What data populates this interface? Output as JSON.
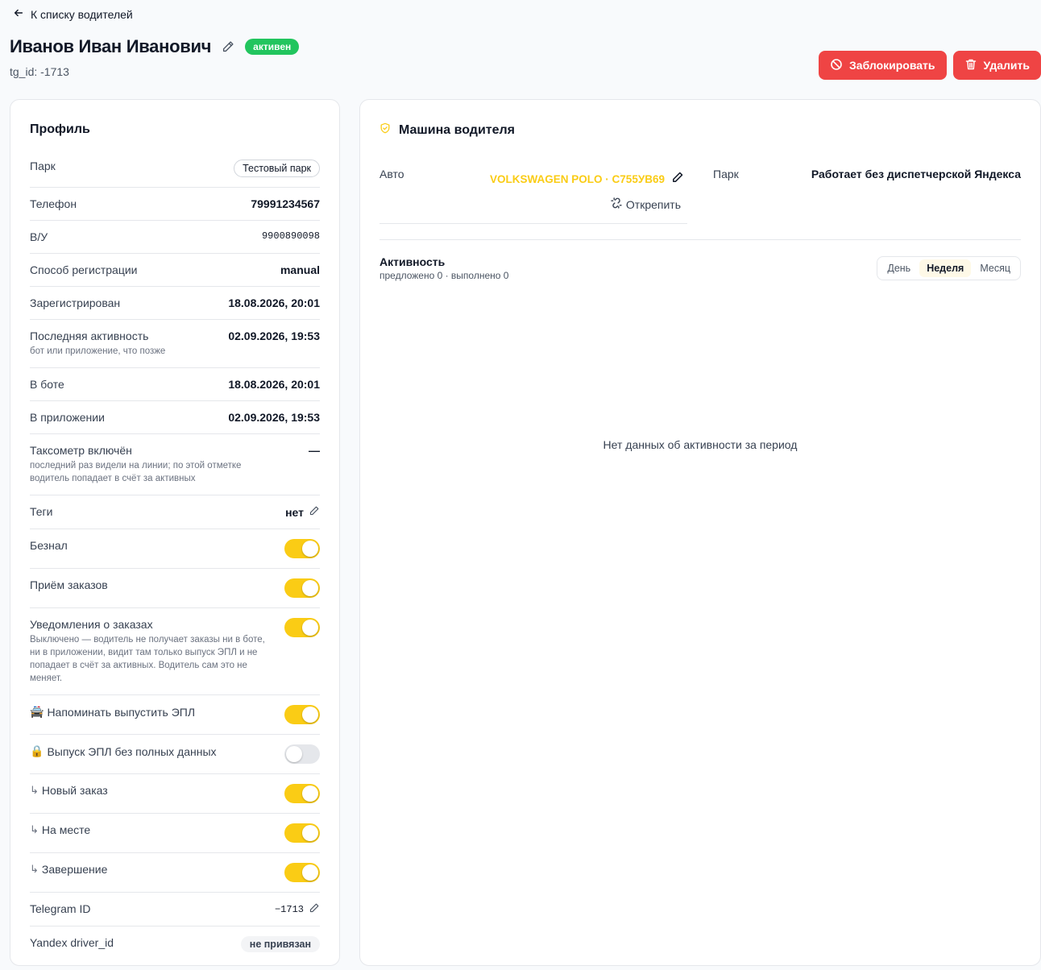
{
  "header": {
    "back_label": "К списку водителей",
    "driver_name": "Иванов Иван Иванович",
    "status": "активен",
    "status_color": "#22c55e",
    "tg_subtitle": "tg_id: -1713",
    "block_label": "Заблокировать",
    "delete_label": "Удалить",
    "danger_color": "#ef4444"
  },
  "profile": {
    "title": "Профиль",
    "park": {
      "label": "Парк",
      "value": "Тестовый парк"
    },
    "phone": {
      "label": "Телефон",
      "value": "79991234567"
    },
    "license": {
      "label": "В/У",
      "value": "9900890098"
    },
    "reg_method": {
      "label": "Способ регистрации",
      "value": "manual"
    },
    "registered": {
      "label": "Зарегистрирован",
      "value": "18.08.2026, 20:01"
    },
    "last_activity": {
      "label": "Последняя активность",
      "hint": "бот или приложение, что позже",
      "value": "02.09.2026, 19:53"
    },
    "in_bot": {
      "label": "В боте",
      "value": "18.08.2026, 20:01"
    },
    "in_app": {
      "label": "В приложении",
      "value": "02.09.2026, 19:53"
    },
    "taximeter": {
      "label": "Таксометр включён",
      "hint": "последний раз видели на линии; по этой отметке водитель попадает в счёт за активных",
      "value": "—"
    },
    "tags": {
      "label": "Теги",
      "value": "нет"
    },
    "cashless": {
      "label": "Безнал",
      "enabled": true
    },
    "order_accept": {
      "label": "Приём заказов",
      "enabled": true
    },
    "order_notify": {
      "label": "Уведомления о заказах",
      "hint": "Выключено — водитель не получает заказы ни в боте, ни в приложении, видит там только выпуск ЭПЛ и не попадает в счёт за активных. Водитель сам это не меняет.",
      "enabled": true
    },
    "remind_epl": {
      "emoji": "🚔",
      "label": "Напоминать выпустить ЭПЛ",
      "enabled": true
    },
    "epl_no_data": {
      "emoji": "🔒",
      "label": "Выпуск ЭПЛ без полных данных",
      "enabled": false
    },
    "new_order": {
      "prefix": "↳",
      "label": "Новый заказ",
      "enabled": true
    },
    "on_place": {
      "prefix": "↳",
      "label": "На месте",
      "enabled": true
    },
    "finish": {
      "prefix": "↳",
      "label": "Завершение",
      "enabled": true
    },
    "telegram_id": {
      "label": "Telegram ID",
      "value": "−1713"
    },
    "yandex_id": {
      "label": "Yandex driver_id",
      "value": "не привязан"
    }
  },
  "car": {
    "title": "Машина водителя",
    "auto_label": "Авто",
    "car_value": "VOLKSWAGEN POLO · С755УВ69",
    "unpin_label": "Открепить",
    "park_label": "Парк",
    "park_value": "Работает без диспетчерской Яндекса",
    "activity_title": "Активность",
    "activity_sub": "предложено 0 · выполнено 0",
    "periods": [
      "День",
      "Неделя",
      "Месяц"
    ],
    "active_period": "Неделя",
    "empty": "Нет данных об активности за период",
    "accent_color": "#facc15"
  }
}
